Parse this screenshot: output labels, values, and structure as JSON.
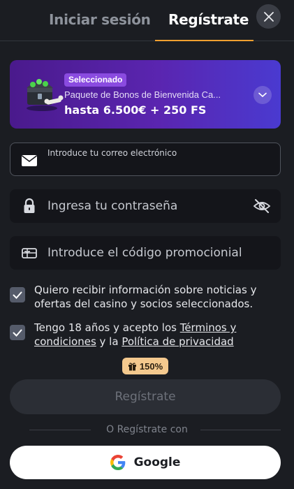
{
  "tabs": {
    "login": "Iniciar sesión",
    "register": "Regístrate"
  },
  "bonus": {
    "badge": "Seleccionado",
    "title": "Paquete de Bonos de Bienvenida Ca...",
    "amount": "hasta 6.500€ + 250 FS"
  },
  "form": {
    "email_placeholder": "Introduce tu correo electrónico",
    "email_value": "",
    "password_placeholder": "Ingresa tu contraseña",
    "promo_placeholder": "Introduce el código promocionial"
  },
  "consents": {
    "news_text": "Quiero recibir información sobre noticias y ofertas del casino y socios seleccionados.",
    "news_checked": true,
    "terms_prefix": "Tengo 18 años y acepto los ",
    "terms_link": "Términos y condiciones",
    "terms_middle": " y la ",
    "privacy_link": "Política de privacidad",
    "terms_checked": true
  },
  "boost_badge": "150%",
  "register_button": "Regístrate",
  "divider_text": "O Regístrate con",
  "google_button": "Google",
  "colors": {
    "background": "#1b1d22",
    "accent": "#f0a030",
    "bonus_gradient_start": "#4a1a8c",
    "bonus_gradient_end": "#4a3ad0"
  }
}
